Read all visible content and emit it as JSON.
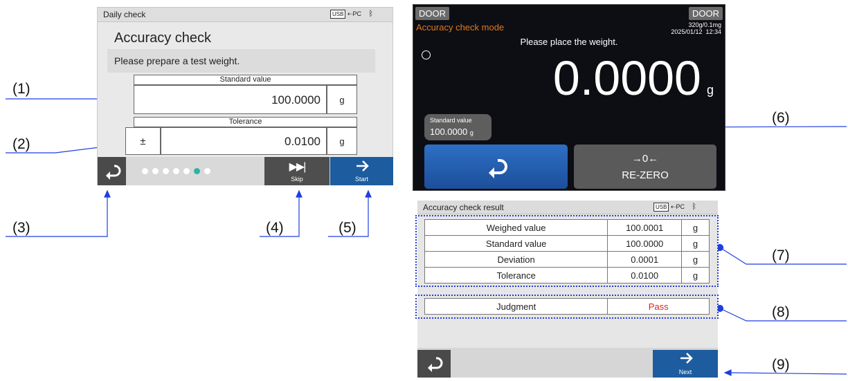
{
  "screen_a": {
    "title": "Daily check",
    "status": {
      "usb": "USB",
      "pc": "PC"
    },
    "heading": "Accuracy check",
    "message": "Please prepare a test weight.",
    "standard": {
      "caption": "Standard value",
      "value": "100.0000",
      "unit": "g"
    },
    "tolerance": {
      "caption": "Tolerance",
      "sign": "±",
      "value": "0.0100",
      "unit": "g"
    },
    "pager": {
      "total": 7,
      "active_index": 5
    },
    "skip_label": "Skip",
    "start_label": "Start"
  },
  "screen_b": {
    "door_left": "DOOR",
    "door_right": "DOOR",
    "mode_title": "Accuracy check mode",
    "capacity": "320g/0.1mg",
    "datetime": "2025/01/12  12:34",
    "instruction": "Please place the weight.",
    "reading": "0.0000",
    "unit": "g",
    "standard_label": "Standard value",
    "standard_value": "100.0000",
    "standard_unit": "g",
    "rezero_symbol": "→0←",
    "rezero_label": "RE-ZERO"
  },
  "screen_c": {
    "title": "Accuracy check result",
    "status": {
      "usb": "USB",
      "pc": "PC"
    },
    "rows": [
      {
        "label": "Weighed value",
        "value": "100.0001",
        "unit": "g"
      },
      {
        "label": "Standard value",
        "value": "100.0000",
        "unit": "g"
      },
      {
        "label": "Deviation",
        "value": "0.0001",
        "unit": "g"
      },
      {
        "label": "Tolerance",
        "value": "0.0100",
        "unit": "g"
      }
    ],
    "judgment": {
      "label": "Judgment",
      "value": "Pass",
      "color": "#e02020"
    },
    "next_label": "Next"
  },
  "callouts": [
    "(1)",
    "(2)",
    "(3)",
    "(4)",
    "(5)",
    "(6)",
    "(7)",
    "(8)",
    "(9)"
  ],
  "colors": {
    "leader_line": "#1f3fe0",
    "start_button": "#1d5c9e",
    "active_dot": "#2db3a4",
    "mode_title": "#e07a1a"
  }
}
